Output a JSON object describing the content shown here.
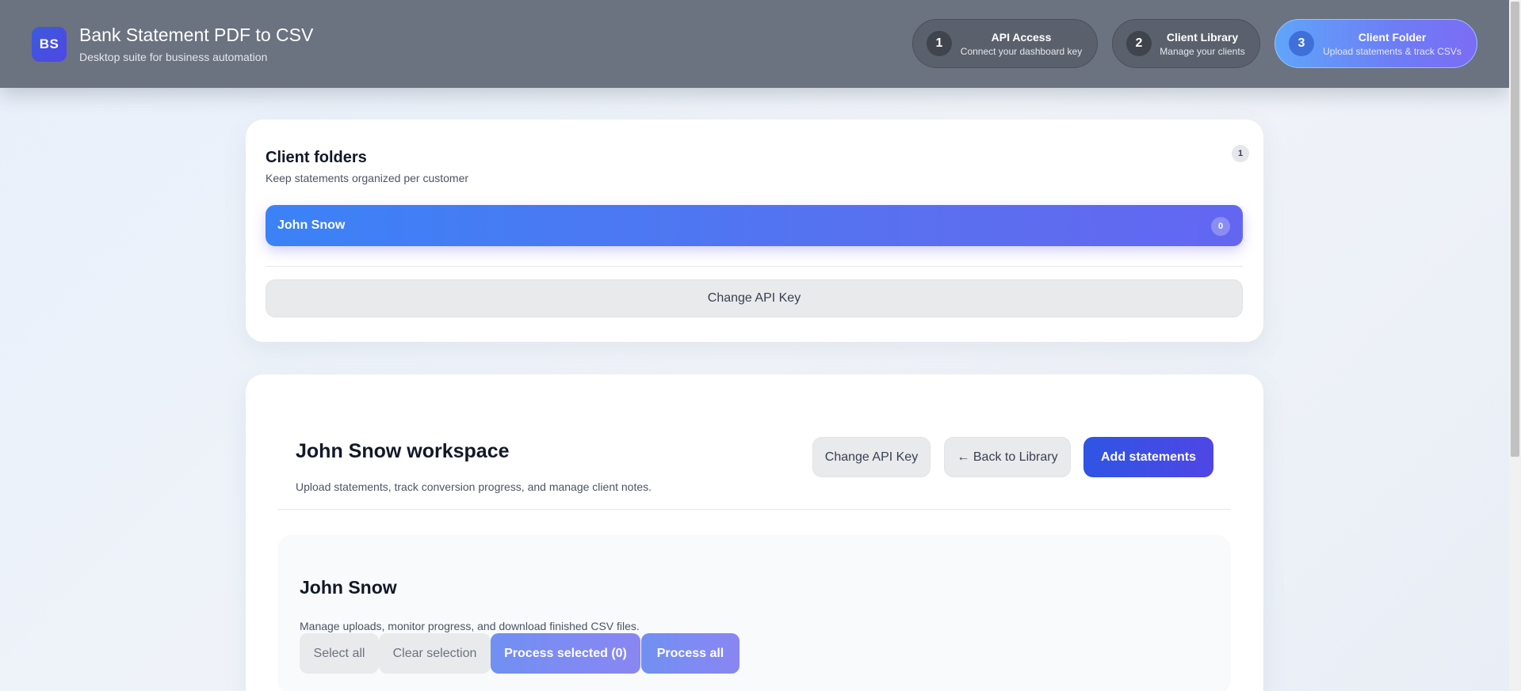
{
  "app": {
    "logo_text": "BS",
    "title": "Bank Statement PDF to CSV",
    "subtitle": "Desktop suite for business automation"
  },
  "steps": [
    {
      "number": "1",
      "title": "API Access",
      "subtitle": "Connect your dashboard key",
      "active": false
    },
    {
      "number": "2",
      "title": "Client Library",
      "subtitle": "Manage your clients",
      "active": false
    },
    {
      "number": "3",
      "title": "Client Folder",
      "subtitle": "Upload statements & track CSVs",
      "active": true
    }
  ],
  "folders": {
    "title": "Client folders",
    "subtitle": "Keep statements organized per customer",
    "count": "1",
    "items": [
      {
        "name": "John Snow",
        "count": "0"
      }
    ],
    "change_api_label": "Change API Key"
  },
  "workspace": {
    "title": "John Snow workspace",
    "subtitle": "Upload statements, track conversion progress, and manage client notes.",
    "change_api_label": "Change API Key",
    "back_label": "← Back to Library",
    "add_label": "Add statements"
  },
  "client_panel": {
    "title": "John Snow",
    "subtitle": "Manage uploads, monitor progress, and download finished CSV files.",
    "select_all_label": "Select all",
    "clear_selection_label": "Clear selection",
    "process_selected_label": "Process selected (0)",
    "process_all_label": "Process all"
  },
  "colors": {
    "header_bg": "#6b7280",
    "accent": "#4f46e5",
    "active_step": "#6d7df5"
  }
}
